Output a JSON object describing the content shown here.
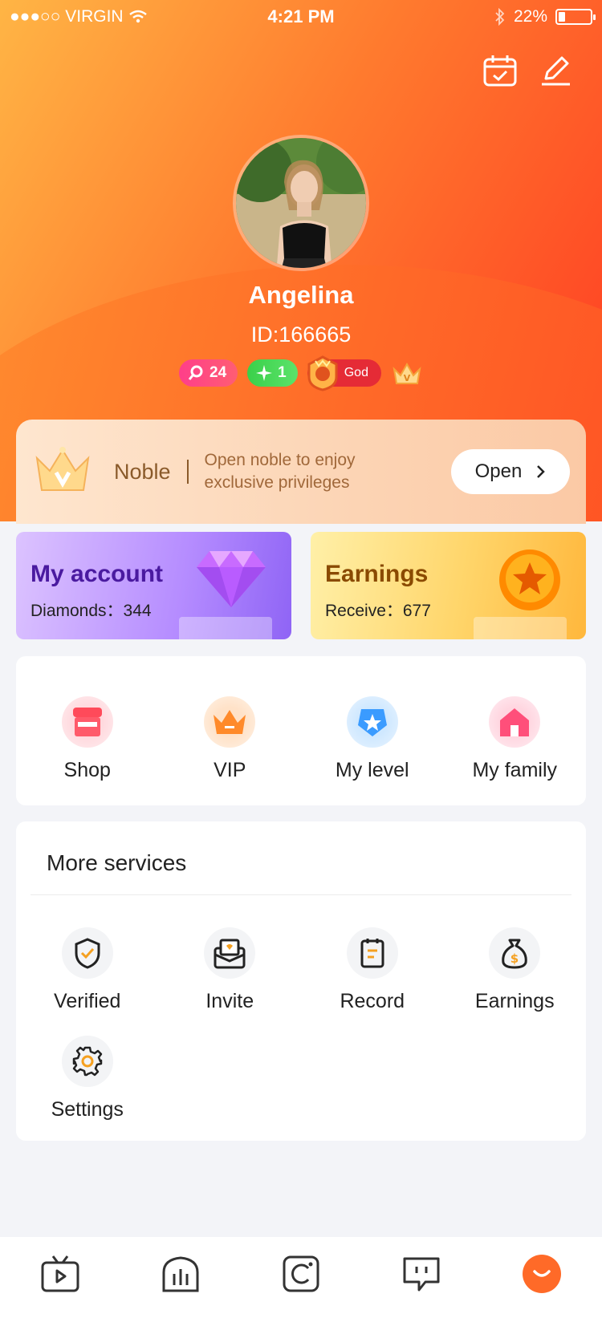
{
  "status_bar": {
    "carrier": "●●●○○ VIRGIN",
    "time": "4:21 PM",
    "battery": "22%"
  },
  "profile": {
    "name": "Angelina",
    "id": "ID:166665"
  },
  "badges": {
    "fans": "24",
    "level": "1",
    "god": "God"
  },
  "noble": {
    "title": "Noble",
    "desc_line1": "Open noble to enjoy",
    "desc_line2": "exclusive privileges",
    "button": "Open"
  },
  "account": {
    "title": "My account",
    "label": "Diamonds：344"
  },
  "earnings": {
    "title": "Earnings",
    "label": "Receive：677"
  },
  "quick_links": [
    {
      "label": "Shop"
    },
    {
      "label": "VIP"
    },
    {
      "label": "My level"
    },
    {
      "label": "My family"
    }
  ],
  "services": {
    "title": "More services",
    "items": [
      {
        "label": "Verified"
      },
      {
        "label": "Invite"
      },
      {
        "label": "Record"
      },
      {
        "label": "Earnings"
      },
      {
        "label": "Settings"
      }
    ]
  },
  "tabbar": {
    "items": [
      "live-tab-icon",
      "explore-tab-icon",
      "moments-tab-icon",
      "messages-tab-icon",
      "me-tab-icon"
    ]
  },
  "colors": {
    "accent": "#ff5a2a",
    "noble_text": "#8a5a2a",
    "account_title": "#4a1aa0",
    "earnings_title": "#8a4a00"
  }
}
